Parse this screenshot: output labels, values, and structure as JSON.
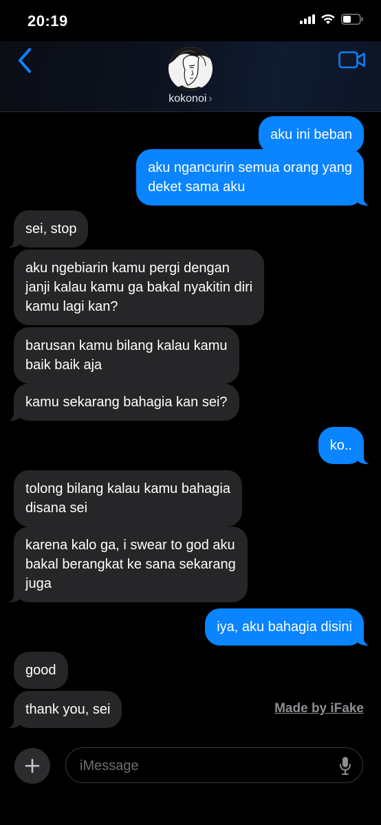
{
  "status": {
    "time": "20:19",
    "icons": [
      "cellular-signal-icon",
      "wifi-icon",
      "battery-icon"
    ]
  },
  "header": {
    "contact_name": "kokonoi",
    "chevron": "›",
    "back_icon": "chevron-left-icon",
    "video_icon": "video-camera-icon"
  },
  "messages": [
    {
      "direction": "sent",
      "text": "aku ini beban"
    },
    {
      "direction": "sent",
      "text": "aku ngancurin semua orang yang\ndeket sama aku"
    },
    {
      "direction": "received",
      "text": "sei, stop"
    },
    {
      "direction": "received",
      "text": "aku ngebiarin kamu pergi dengan\njanji kalau kamu ga bakal nyakitin diri\nkamu lagi kan?"
    },
    {
      "direction": "received",
      "text": "barusan kamu bilang kalau kamu\nbaik baik aja"
    },
    {
      "direction": "received",
      "text": "kamu sekarang bahagia kan sei?"
    },
    {
      "direction": "sent",
      "text": "ko.."
    },
    {
      "direction": "received",
      "text": "tolong bilang kalau kamu bahagia\ndisana sei"
    },
    {
      "direction": "received",
      "text": "karena kalo ga, i swear to god aku\nbakal berangkat ke sana sekarang\njuga"
    },
    {
      "direction": "sent",
      "text": "iya, aku bahagia disini"
    },
    {
      "direction": "received",
      "text": "good"
    },
    {
      "direction": "received",
      "text": "thank you, sei"
    }
  ],
  "watermark": "Made by iFake",
  "input": {
    "placeholder": "iMessage",
    "value": "",
    "plus_icon": "plus-icon",
    "mic_icon": "microphone-icon"
  },
  "colors": {
    "sent_bubble": "#0a84ff",
    "received_bubble": "#262628",
    "accent": "#0a84ff",
    "background": "#000000"
  }
}
